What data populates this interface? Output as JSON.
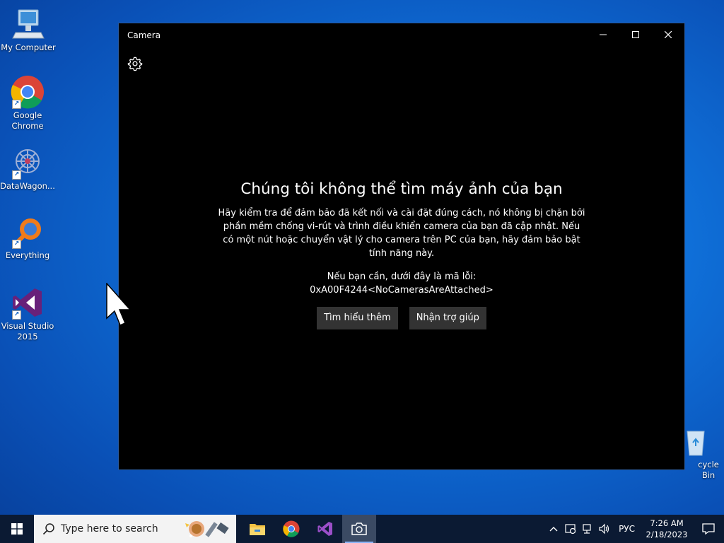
{
  "desktop": {
    "icons": [
      {
        "label": "My Computer",
        "icon": "computer-icon"
      },
      {
        "label": "Google Chrome",
        "icon": "chrome-icon"
      },
      {
        "label": "DataWagon...",
        "icon": "datawagon-icon"
      },
      {
        "label": "Everything",
        "icon": "everything-search-icon"
      },
      {
        "label": "Visual Studio 2015",
        "icon": "visual-studio-icon"
      },
      {
        "label": "cycle Bin",
        "icon": "recycle-bin-icon"
      }
    ]
  },
  "window": {
    "title": "Camera",
    "settings_icon": "gear-icon",
    "heading": "Chúng tôi không thể tìm máy ảnh của bạn",
    "description": "Hãy kiểm tra để đảm bảo đã kết nối và cài đặt đúng cách, nó không bị chặn bởi phần mềm chống vi-rút và trình điều khiển camera của bạn đã cập nhật. Nếu có một nút hoặc chuyển vật lý cho camera trên PC của bạn, hãy đảm bảo bật tính năng này.",
    "error_intro": "Nếu bạn cần, dưới đây là mã lỗi:",
    "error_code": "0xA00F4244<NoCamerasAreAttached>",
    "buttons": {
      "learn_more": "Tìm hiểu thêm",
      "get_help": "Nhận trợ giúp"
    }
  },
  "taskbar": {
    "search_placeholder": "Type here to search",
    "apps": [
      "file-explorer-icon",
      "chrome-icon",
      "visual-studio-icon",
      "camera-icon"
    ],
    "active_app": "camera-icon",
    "language": "РУС",
    "time": "7:26 AM",
    "date": "2/18/2023"
  },
  "colors": {
    "window_bg": "#000000",
    "button_bg": "#333333",
    "taskbar_bg": "#0b1a33"
  }
}
